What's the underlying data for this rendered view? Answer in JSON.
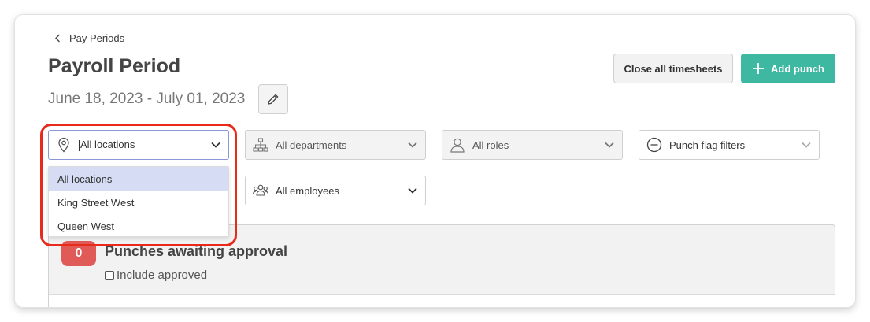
{
  "header": {
    "breadcrumb": "Pay Periods",
    "title": "Payroll Period",
    "date_range": "June 18, 2023 - July 01, 2023"
  },
  "actions": {
    "close_all": "Close all timesheets",
    "add_punch": "Add punch"
  },
  "filters": {
    "locations": {
      "value": "All locations",
      "icon": "map-pin-icon"
    },
    "departments": {
      "value": "All departments",
      "icon": "org-chart-icon"
    },
    "roles": {
      "value": "All roles",
      "icon": "user-icon"
    },
    "punch_flags": {
      "value": "Punch flag filters",
      "icon": "minus-circle-icon"
    },
    "employees": {
      "value": "All employees",
      "icon": "users-group-icon"
    }
  },
  "location_dropdown": {
    "options": [
      "All locations",
      "King Street West",
      "Queen West"
    ],
    "selected": "All locations"
  },
  "approval_panel": {
    "count": "0",
    "title": "Punches awaiting approval",
    "include_approved_label": "Include approved"
  },
  "colors": {
    "primary": "#3fb8a2",
    "highlight": "#e82a1b",
    "badge": "#e05a58",
    "selected_option": "#d6dcf3"
  }
}
